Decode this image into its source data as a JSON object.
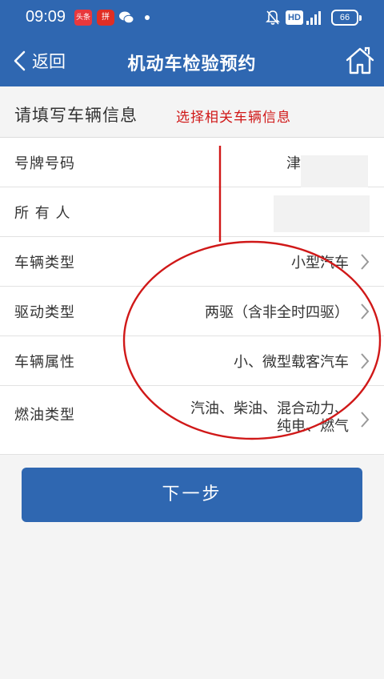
{
  "status_bar": {
    "time": "09:09",
    "toutiao_label": "头条",
    "pdd_label": "拼",
    "hd_label": "HD",
    "battery_level": "66"
  },
  "nav": {
    "back_label": "返回",
    "title": "机动车检验预约"
  },
  "section": {
    "title": "请填写车辆信息"
  },
  "annotation": {
    "text": "选择相关车辆信息",
    "color": "#d01818"
  },
  "rows": [
    {
      "label": "号牌号码",
      "value": "津"
    },
    {
      "label": "所 有 人",
      "value": ""
    },
    {
      "label": "车辆类型",
      "value": "小型汽车"
    },
    {
      "label": "驱动类型",
      "value": "两驱（含非全时四驱）"
    },
    {
      "label": "车辆属性",
      "value": "小、微型载客汽车"
    },
    {
      "label": "燃油类型",
      "value": "汽油、柴油、混合动力、纯电、燃气"
    }
  ],
  "next_button": {
    "label": "下一步"
  },
  "colors": {
    "brand": "#2f67b1",
    "background": "#f4f4f4"
  }
}
